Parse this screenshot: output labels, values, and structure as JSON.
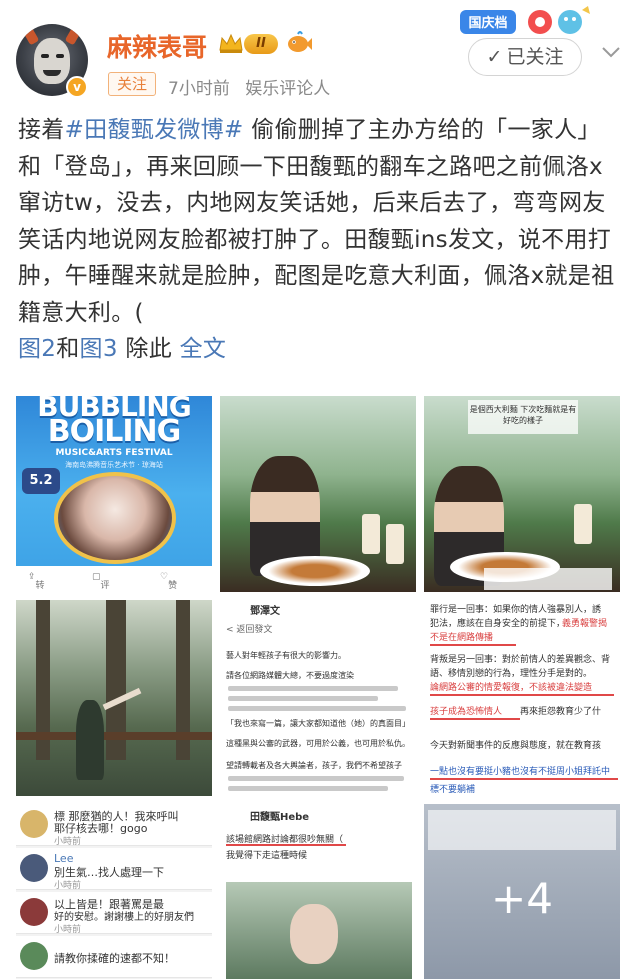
{
  "header": {
    "name": "麻辣表哥",
    "level_badge": "II",
    "follow_tag": "关注",
    "time": "7小时前",
    "category": "娱乐评论人",
    "holiday_badge": "国庆档",
    "followed_button": "已关注",
    "verified_mark": "v"
  },
  "post": {
    "prefix": "接着",
    "topic": "#田馥甄发微博#",
    "text": " 偷偷删掉了主办方给的「一家人」和「登岛」，再来回顾一下田馥甄的翻车之路吧之前佩洛ⅹ窜访tw，没去，内地网友笑话她，后来后去了，弯弯网友笑话内地说网友脸都被打肿了。田馥甄ins发文，说不用打肿，午睡醒来就是脸肿，配图是吃意大利面，佩洛ⅹ就是祖籍意大利。(",
    "link_fig2": "图2",
    "link_and": "和",
    "link_fig3": "图3",
    "after_links": " 除此 ",
    "full_text": "全文"
  },
  "images": {
    "poster": {
      "title_line1": "BUBBLING",
      "title_line2": "BOILING",
      "subtitle": "MUSIC&ARTS FESTIVAL",
      "subtitle_cn": "海南岛沸腾音乐艺术节 · 琼海站",
      "date": "5.2",
      "repost": "转发",
      "comment": "评论",
      "like": "赞"
    },
    "photo3_caption": "是個西大利麵\n下次吃麵就是有好吃的樣子",
    "doc_name": "鄧澤文",
    "doc_back": "< 返回發文",
    "doc_line1": "藝人對年輕孩子有很大的影響力。",
    "doc_line2": "請各位網路媒體大總，不要過度渲染",
    "doc_line3": "「我也來寫一篇，讓大家都知道他（她）的真面目」",
    "doc_line4": "這種黑與公審的武器，可用於公義，也可用於私仇。",
    "doc_line5": "望請轉載者及各大輿論者，孩子，我們不希望孩子",
    "doc2_line1": "罪行是一回事：如果你的情人強暴別人，誘",
    "doc2_line2": "犯法，應該在自身安全的前提下，",
    "doc2_hl1": "義勇報警揭",
    "doc2_hl2": "不是在網路傳播",
    "doc2_line3": "背叛是另一回事：對於前情人的差異觀念、背",
    "doc2_line4": "語、移情別戀的行為，理性分手是對的。",
    "doc2_hl3": "論網路公審的情愛報復，不該被違法變造",
    "doc2_hl4": "孩子成為恐怖情人",
    "doc2_line5": "再來拒怨教育少了什",
    "doc2_line6": "今天對新聞事件的反應與態度，就在教育孩",
    "doc2_hl5": "一點也沒有要挺小豬也沒有不挺周小姐拜託中",
    "doc2_hl6": "標不要躺補",
    "chat": {
      "row1": "標 那麼猶的人！我來呼叫",
      "row1b": "耶仔核去哪！gogo",
      "row1_time": "小時前",
      "row2_name": "Lee",
      "row2": "別生氣…找人處理一下",
      "row2_time": "小時前",
      "row3": "以上皆是！跟著罵是最",
      "row3b": "好的安慰。謝謝樓上的好朋友們",
      "row3_time": "小時前",
      "row4": "請教你揉確的速都不知！"
    },
    "insta_name": "田馥甄Hebe",
    "insta_line1": "該場館網路討論都很吵無關（",
    "insta_line2": "我覺得下走這種時候",
    "more_count": "+4"
  }
}
